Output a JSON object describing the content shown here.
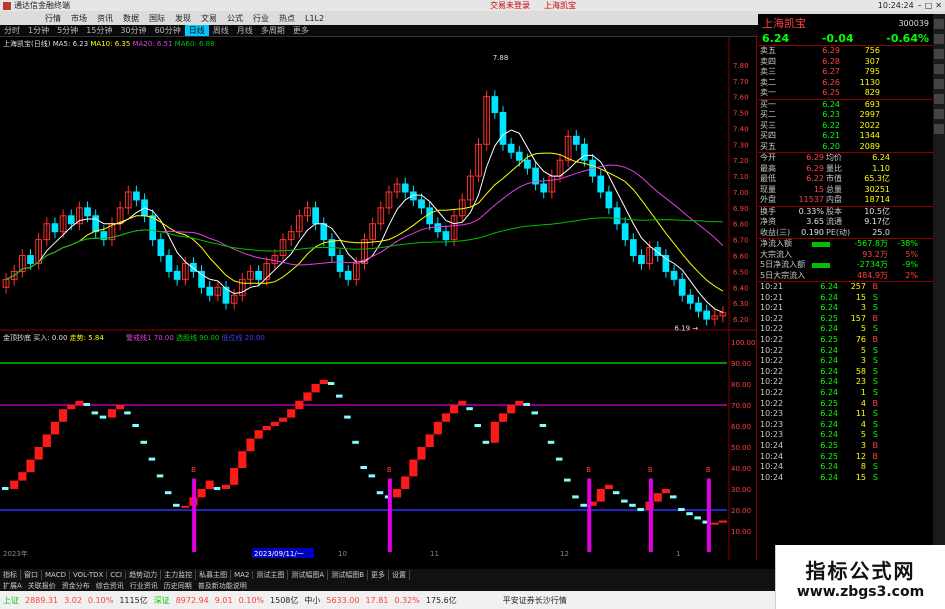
{
  "window": {
    "title": "通达信金融终端",
    "promo": "交易未登录",
    "stock_name_top": "上海凯宝",
    "clock": "10:24:24"
  },
  "menu": [
    "行情",
    "市场",
    "资讯",
    "数据",
    "国际",
    "发现",
    "文易",
    "公式",
    "行业",
    "热点",
    "L1L2"
  ],
  "menu_right": [
    "功能",
    "数据",
    "公式",
    "选项",
    "帮助",
    "返回"
  ],
  "toolbar": [
    "分时",
    "1分钟",
    "5分钟",
    "15分钟",
    "30分钟",
    "60分钟",
    "日线",
    "周线",
    "月线",
    "多周期",
    "更多"
  ],
  "toolbar_selected": "日线",
  "legend_main": {
    "name": "上海凯宝(日线)",
    "ma5": "MA5: 6.23",
    "ma10": "MA10: 6.35",
    "ma20": "MA20: 6.51",
    "ma60": "MA60: 6.88"
  },
  "legend_sub": {
    "name": "金顶抄底",
    "buy": "买入: 0.00",
    "trend": "走势: 5.84",
    "warn": "警戒线1",
    "warn_val": "70.00",
    "sel": "选股线",
    "sel_val": "90.00",
    "low": "低位线",
    "low_val": "20.00"
  },
  "price_axis": [
    "7.80",
    "7.70",
    "7.60",
    "7.50",
    "7.40",
    "7.30",
    "7.20",
    "7.10",
    "7.00",
    "6.90",
    "6.80",
    "6.70",
    "6.60",
    "6.50",
    "6.40",
    "6.30",
    "6.20"
  ],
  "ind_axis": [
    "100.00",
    "90.00",
    "80.00",
    "70.00",
    "60.00",
    "50.00",
    "40.00",
    "30.00",
    "20.00",
    "10.00"
  ],
  "annotations": {
    "high": "7.88",
    "low": "6.19"
  },
  "date_labels": {
    "year": "2023年",
    "cursor": "2023/09/11/一",
    "m1": "10",
    "m2": "11",
    "m3": "12",
    "m4": "1"
  },
  "panel": {
    "name": "上海凯宝",
    "code": "300039",
    "price": "6.24",
    "change": "-0.04",
    "pct": "-0.64%",
    "asks": [
      {
        "label": "卖五",
        "p": "6.29",
        "v": "756"
      },
      {
        "label": "卖四",
        "p": "6.28",
        "v": "307"
      },
      {
        "label": "卖三",
        "p": "6.27",
        "v": "795"
      },
      {
        "label": "卖二",
        "p": "6.26",
        "v": "1130"
      },
      {
        "label": "卖一",
        "p": "6.25",
        "v": "829"
      }
    ],
    "bids": [
      {
        "label": "买一",
        "p": "6.24",
        "v": "693"
      },
      {
        "label": "买二",
        "p": "6.23",
        "v": "2997"
      },
      {
        "label": "买三",
        "p": "6.22",
        "v": "2022"
      },
      {
        "label": "买四",
        "p": "6.21",
        "v": "1344"
      },
      {
        "label": "买五",
        "p": "6.20",
        "v": "2089"
      }
    ],
    "stats": [
      [
        "今开",
        "6.29",
        "均价",
        "6.24"
      ],
      [
        "最高",
        "6.29",
        "量比",
        "1.10"
      ],
      [
        "最低",
        "6.22",
        "市值",
        "65.3亿"
      ],
      [
        "现量",
        "15",
        "总量",
        "30251"
      ],
      [
        "外盘",
        "11537",
        "内盘",
        "18714"
      ]
    ],
    "stats2": [
      [
        "换手",
        "0.33%",
        "股本",
        "10.5亿"
      ],
      [
        "净资",
        "3.65",
        "流通",
        "9.17亿"
      ],
      [
        "收益(三)",
        "0.190",
        "PE(动)",
        "25.0"
      ]
    ],
    "flows": [
      {
        "label": "净流入额",
        "val": "-567.8万",
        "pct": "-38%"
      },
      {
        "label": "大宗流入",
        "val": "93.2万",
        "pct": "5%"
      },
      {
        "label": "5日净流入额",
        "val": "-2734万",
        "pct": "-9%"
      },
      {
        "label": "5日大宗流入",
        "val": "484.9万",
        "pct": "2%"
      }
    ],
    "ticks": [
      [
        "10:21",
        "6.24",
        "257",
        "B"
      ],
      [
        "10:21",
        "6.24",
        "15",
        "S"
      ],
      [
        "10:21",
        "6.24",
        "3",
        "S"
      ],
      [
        "10:22",
        "6.25",
        "157",
        "B"
      ],
      [
        "10:22",
        "6.24",
        "5",
        "S"
      ],
      [
        "10:22",
        "6.25",
        "76",
        "B"
      ],
      [
        "10:22",
        "6.24",
        "5",
        "S"
      ],
      [
        "10:22",
        "6.24",
        "3",
        "S"
      ],
      [
        "10:22",
        "6.24",
        "58",
        "S"
      ],
      [
        "10:22",
        "6.24",
        "23",
        "S"
      ],
      [
        "10:22",
        "6.24",
        "1",
        "S"
      ],
      [
        "10:22",
        "6.25",
        "4",
        "B"
      ],
      [
        "10:23",
        "6.24",
        "11",
        "S"
      ],
      [
        "10:23",
        "6.24",
        "4",
        "S"
      ],
      [
        "10:23",
        "6.24",
        "5",
        "S"
      ],
      [
        "10:24",
        "6.25",
        "3",
        "B"
      ],
      [
        "10:24",
        "6.25",
        "12",
        "B"
      ],
      [
        "10:24",
        "6.24",
        "8",
        "S"
      ],
      [
        "10:24",
        "6.24",
        "15",
        "S"
      ]
    ]
  },
  "bottom_tabs": [
    "指标",
    "窗口",
    "MACD",
    "VOL-TDX",
    "CCI",
    "趋势动力",
    "主力监控",
    "私募主图",
    "MA2",
    "测试主图",
    "测试幅图A",
    "测试幅图B",
    "更多",
    "设置"
  ],
  "bottom_tabs2": [
    "扩展A",
    "关联报价",
    "资金分布",
    "综合资讯",
    "行业资讯",
    "历史同期",
    "普及新功能说明"
  ],
  "status": {
    "sh_name": "上证",
    "sh_val": "2889.31",
    "sh_chg": "3.02",
    "sh_pct": "0.10%",
    "sh_amt": "1115亿",
    "sz_name": "深证",
    "sz_val": "8972.94",
    "sz_chg": "9.01",
    "sz_pct": "0.10%",
    "sz_amt": "1508亿",
    "zx_name": "中小",
    "zx_val": "5633.00",
    "zx_chg": "17.81",
    "zx_pct": "0.32%",
    "zx_amt": "175.6亿",
    "broker": "平安证券长沙行情"
  },
  "watermark": {
    "line1": "指标公式网",
    "line2": "www.zbgs3.com"
  },
  "colors": {
    "up": "#ff3030",
    "down": "#00e5ff",
    "ma5": "#ffffff",
    "ma10": "#ffff00",
    "ma20": "#e040e0",
    "ma60": "#00c000"
  },
  "chart_data": [
    {
      "type": "candlestick",
      "title": "上海凯宝(日线)",
      "ylim": [
        6.15,
        7.9
      ],
      "series_ma": [
        "MA5",
        "MA10",
        "MA20",
        "MA60"
      ],
      "close": [
        6.45,
        6.5,
        6.6,
        6.55,
        6.7,
        6.8,
        6.75,
        6.85,
        6.8,
        6.9,
        6.85,
        6.75,
        6.7,
        6.8,
        6.9,
        7.0,
        6.95,
        6.85,
        6.7,
        6.6,
        6.5,
        6.45,
        6.55,
        6.5,
        6.4,
        6.35,
        6.4,
        6.3,
        6.35,
        6.45,
        6.5,
        6.45,
        6.55,
        6.6,
        6.7,
        6.75,
        6.85,
        6.9,
        6.8,
        6.7,
        6.6,
        6.5,
        6.45,
        6.55,
        6.7,
        6.8,
        6.9,
        7.0,
        7.05,
        7.0,
        6.95,
        6.9,
        6.8,
        6.75,
        6.7,
        6.85,
        6.95,
        7.1,
        7.3,
        7.6,
        7.5,
        7.3,
        7.25,
        7.2,
        7.15,
        7.05,
        7.0,
        7.1,
        7.2,
        7.35,
        7.3,
        7.2,
        7.1,
        7.0,
        6.9,
        6.8,
        6.7,
        6.6,
        6.55,
        6.65,
        6.6,
        6.5,
        6.45,
        6.35,
        6.3,
        6.25,
        6.2,
        6.22,
        6.24
      ]
    },
    {
      "type": "line",
      "title": "金顶抄底",
      "ylim": [
        0,
        100
      ],
      "lines": {
        "warn": 70,
        "select": 90,
        "low": 20
      },
      "values": [
        30,
        34,
        38,
        44,
        50,
        56,
        62,
        68,
        70,
        72,
        70,
        66,
        64,
        68,
        70,
        66,
        60,
        52,
        44,
        36,
        28,
        22,
        22,
        26,
        30,
        34,
        30,
        32,
        40,
        48,
        54,
        58,
        60,
        62,
        64,
        68,
        72,
        76,
        80,
        82,
        80,
        74,
        64,
        52,
        40,
        36,
        28,
        26,
        30,
        36,
        44,
        50,
        56,
        62,
        66,
        70,
        72,
        68,
        60,
        52,
        62,
        66,
        70,
        72,
        70,
        66,
        60,
        52,
        44,
        34,
        26,
        22,
        24,
        30,
        32,
        28,
        24,
        22,
        20,
        24,
        28,
        30,
        26,
        20,
        18,
        16,
        14,
        14,
        15
      ]
    }
  ]
}
